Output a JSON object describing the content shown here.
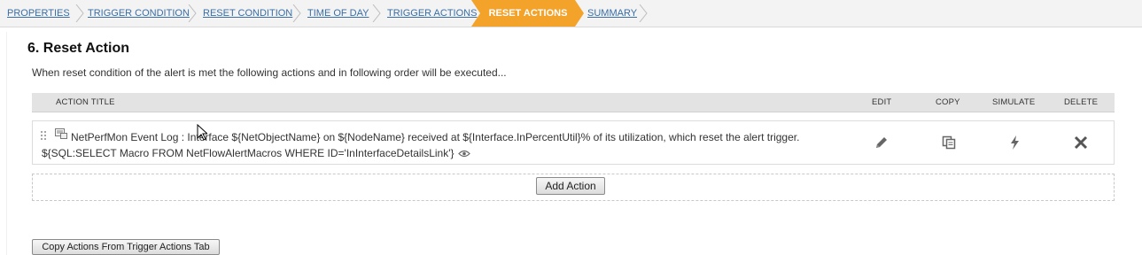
{
  "wizard": {
    "steps": [
      {
        "label": "PROPERTIES"
      },
      {
        "label": "TRIGGER CONDITION"
      },
      {
        "label": "RESET CONDITION"
      },
      {
        "label": "TIME OF DAY"
      },
      {
        "label": "TRIGGER ACTIONS"
      },
      {
        "label": "RESET ACTIONS"
      },
      {
        "label": "SUMMARY"
      }
    ],
    "active_step": "RESET ACTIONS",
    "active_color": "#f3a22a",
    "link_color": "#3a6ea5"
  },
  "section": {
    "title": "6. Reset Action",
    "description": "When reset condition of the alert is met the following actions and in following order will be executed..."
  },
  "table": {
    "columns": {
      "action_title": "ACTION TITLE",
      "edit": "EDIT",
      "copy": "COPY",
      "simulate": "SIMULATE",
      "delete": "DELETE"
    },
    "rows": [
      {
        "text": "NetPerfMon Event Log : Interface ${NetObjectName} on ${NodeName} received at ${Interface.InPercentUtil}% of its utilization, which reset the alert trigger. ${SQL:SELECT Macro FROM NetFlowAlertMacros WHERE ID='InInterfaceDetailsLink'}",
        "icons": [
          "drag-handle-icon",
          "event-log-icon",
          "eye-icon",
          "pencil-icon",
          "copy-icon",
          "lightning-icon",
          "close-icon"
        ]
      }
    ]
  },
  "buttons": {
    "add_action": "Add Action",
    "copy_actions": "Copy Actions From Trigger Actions Tab"
  }
}
